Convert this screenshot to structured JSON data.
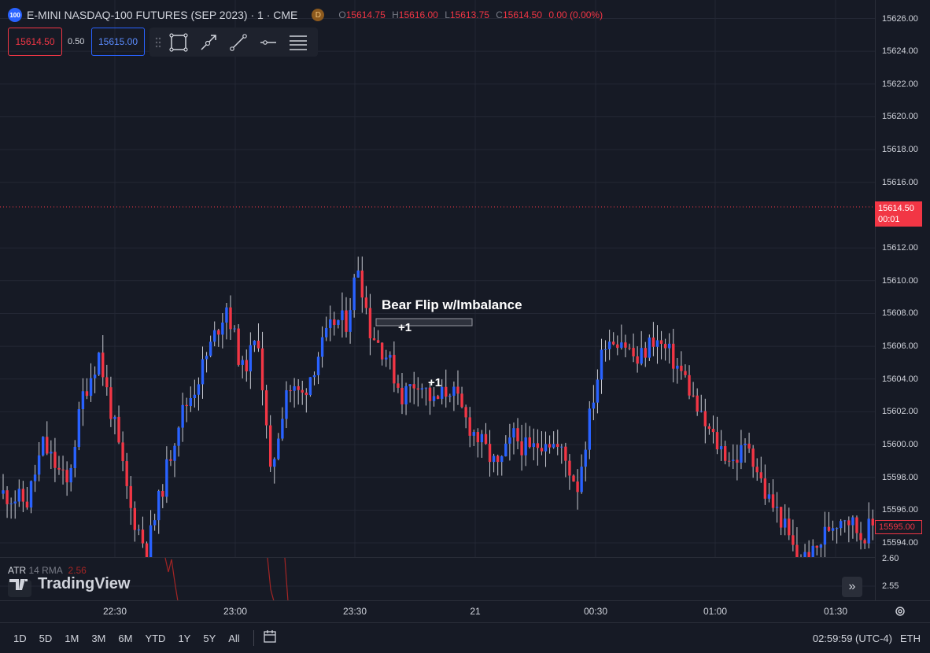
{
  "header": {
    "symbol_badge": "100",
    "title": "E-MINI NASDAQ-100 FUTURES (SEP 2023) · 1 · CME",
    "data_badge": "D",
    "ohlc": {
      "o_label": "O",
      "o": "15614.75",
      "h_label": "H",
      "h": "15616.00",
      "l_label": "L",
      "l": "15613.75",
      "c_label": "C",
      "c": "15614.50",
      "change": "0.00 (0.00%)"
    }
  },
  "order_panel": {
    "sell_price": "15614.50",
    "spread": "0.50",
    "buy_price": "15615.00"
  },
  "drawing_toolbar": {
    "tools": [
      "rectangle-icon",
      "trend-line-arrow-icon",
      "line-icon",
      "horizontal-ray-icon",
      "more-lines-icon"
    ]
  },
  "annotations": {
    "label": "Bear Flip w/Imbalance",
    "marker_1": "+1",
    "marker_2": "+1"
  },
  "price_axis": {
    "ticks": [
      "15626.00",
      "15624.00",
      "15622.00",
      "15620.00",
      "15618.00",
      "15616.00",
      "15612.00",
      "15610.00",
      "15608.00",
      "15606.00",
      "15604.00",
      "15602.00",
      "15600.00",
      "15598.00",
      "15596.00",
      "15594.00"
    ],
    "current_price": "15614.50",
    "countdown": "00:01",
    "order_price": "15595.00"
  },
  "indicator": {
    "name": "ATR",
    "params": "14 RMA",
    "value": "2.56",
    "axis_ticks": [
      "2.60",
      "2.55"
    ]
  },
  "time_axis": {
    "ticks": [
      "22:30",
      "23:00",
      "23:30",
      "21",
      "00:30",
      "01:00",
      "01:30"
    ]
  },
  "bottom_bar": {
    "ranges": [
      "1D",
      "5D",
      "1M",
      "3M",
      "6M",
      "YTD",
      "1Y",
      "5Y",
      "All"
    ],
    "clock": "02:59:59 (UTC-4)",
    "session": "ETH"
  },
  "branding": {
    "logo_text": "TradingView"
  },
  "colors": {
    "background": "#161a25",
    "up": "#2962ff",
    "down": "#f23645",
    "grid": "#232734",
    "atr_line": "#a32525"
  },
  "chart_data": {
    "type": "candlestick",
    "title": "E-MINI NASDAQ-100 FUTURES (SEP 2023)",
    "interval": "1",
    "yticks": [
      15594,
      15596,
      15598,
      15600,
      15602,
      15604,
      15606,
      15608,
      15610,
      15612,
      15616,
      15618,
      15620,
      15622,
      15624,
      15626
    ],
    "xticks": [
      "22:30",
      "23:00",
      "23:30",
      "21",
      "00:30",
      "01:00",
      "01:30"
    ],
    "ylim": [
      15593.2,
      15627.0
    ],
    "current_price": 15614.5,
    "anchors": [
      [
        0,
        15597.0
      ],
      [
        6,
        15596.5
      ],
      [
        10,
        15600.0
      ],
      [
        16,
        15597.5
      ],
      [
        20,
        15603.0
      ],
      [
        24,
        15605.5
      ],
      [
        28,
        15601.0
      ],
      [
        32,
        15596.0
      ],
      [
        36,
        15593.5
      ],
      [
        40,
        15597.5
      ],
      [
        44,
        15601.5
      ],
      [
        48,
        15603.5
      ],
      [
        52,
        15606.0
      ],
      [
        56,
        15608.5
      ],
      [
        60,
        15604.5
      ],
      [
        64,
        15606.5
      ],
      [
        67,
        15598.0
      ],
      [
        71,
        15603.5
      ],
      [
        75,
        15603.0
      ],
      [
        79,
        15605.5
      ],
      [
        83,
        15607.5
      ],
      [
        86,
        15607.5
      ],
      [
        89,
        15611.0
      ],
      [
        92,
        15607.0
      ],
      [
        96,
        15605.5
      ],
      [
        100,
        15603.0
      ],
      [
        104,
        15604.0
      ],
      [
        108,
        15602.5
      ],
      [
        112,
        15603.5
      ],
      [
        116,
        15601.5
      ],
      [
        120,
        15600.0
      ],
      [
        124,
        15598.5
      ],
      [
        128,
        15600.5
      ],
      [
        132,
        15599.5
      ],
      [
        136,
        15600.5
      ],
      [
        140,
        15599.5
      ],
      [
        144,
        15597.5
      ],
      [
        148,
        15603.0
      ],
      [
        151,
        15606.5
      ],
      [
        155,
        15606.5
      ],
      [
        159,
        15605.0
      ],
      [
        163,
        15606.5
      ],
      [
        167,
        15605.5
      ],
      [
        171,
        15604.0
      ],
      [
        175,
        15601.5
      ],
      [
        179,
        15600.0
      ],
      [
        183,
        15599.0
      ],
      [
        187,
        15600.0
      ],
      [
        191,
        15597.0
      ],
      [
        195,
        15595.5
      ],
      [
        199,
        15593.0
      ],
      [
        203,
        15593.2
      ],
      [
        207,
        15595.0
      ],
      [
        211,
        15595.8
      ],
      [
        215,
        15594.5
      ],
      [
        218,
        15595.0
      ]
    ],
    "atr": {
      "name": "ATR",
      "length": 14,
      "smoothing": "RMA",
      "last": 2.56,
      "axis_ticks": [
        2.6,
        2.55
      ]
    }
  }
}
